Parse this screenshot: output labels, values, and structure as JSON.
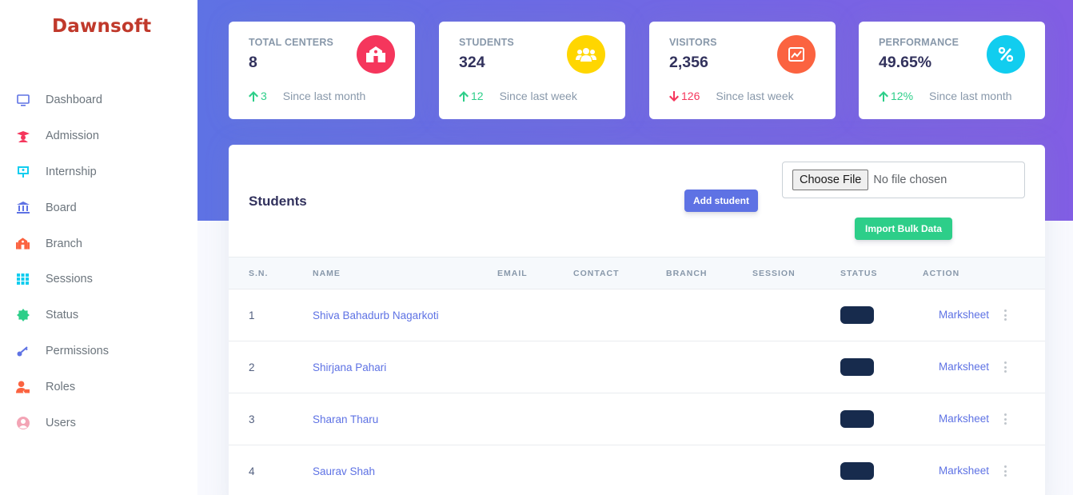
{
  "brand": "Dawnsoft",
  "nav": [
    {
      "label": "Dashboard",
      "icon": "monitor-icon",
      "color": "#5e72e4"
    },
    {
      "label": "Admission",
      "icon": "graduation-cap-icon",
      "color": "#f5365c"
    },
    {
      "label": "Internship",
      "icon": "presentation-board-icon",
      "color": "#11cdef"
    },
    {
      "label": "Board",
      "icon": "bank-icon",
      "color": "#5e72e4"
    },
    {
      "label": "Branch",
      "icon": "school-icon",
      "color": "#fb6340"
    },
    {
      "label": "Sessions",
      "icon": "grid-icon",
      "color": "#11cdef"
    },
    {
      "label": "Status",
      "icon": "badge-icon",
      "color": "#2dce89"
    },
    {
      "label": "Permissions",
      "icon": "key-icon",
      "color": "#5e72e4"
    },
    {
      "label": "Roles",
      "icon": "user-tag-icon",
      "color": "#fb6340"
    },
    {
      "label": "Users",
      "icon": "user-circle-icon",
      "color": "#f3a4b5"
    }
  ],
  "stats": [
    {
      "title": "Total Centers",
      "value": "8",
      "trend": "up",
      "change": "3",
      "since": "Since last month",
      "icon": "school-icon",
      "color": "#f5365c"
    },
    {
      "title": "Students",
      "value": "324",
      "trend": "up",
      "change": "12",
      "since": "Since last week",
      "icon": "users-icon",
      "color": "#ffd600"
    },
    {
      "title": "Visitors",
      "value": "2,356",
      "trend": "down",
      "change": "126",
      "since": "Since last week",
      "icon": "chart-line-icon",
      "color": "#fb6340"
    },
    {
      "title": "Performance",
      "value": "49.65%",
      "trend": "up",
      "change": "12%",
      "since": "Since last month",
      "icon": "percent-icon",
      "color": "#11cdef"
    }
  ],
  "students_panel": {
    "title": "Students",
    "add_label": "Add student",
    "file_button": "Choose File",
    "file_status": "No file chosen",
    "import_label": "Import Bulk Data",
    "columns": [
      "S.N.",
      "Name",
      "Email",
      "Contact",
      "Branch",
      "Session",
      "Status",
      "Action"
    ],
    "rows": [
      {
        "sn": "1",
        "name": "Shiva Bahadurb Nagarkoti",
        "action": "Marksheet"
      },
      {
        "sn": "2",
        "name": "Shirjana Pahari",
        "action": "Marksheet"
      },
      {
        "sn": "3",
        "name": "Sharan Tharu",
        "action": "Marksheet"
      },
      {
        "sn": "4",
        "name": "Saurav Shah",
        "action": "Marksheet"
      }
    ]
  }
}
